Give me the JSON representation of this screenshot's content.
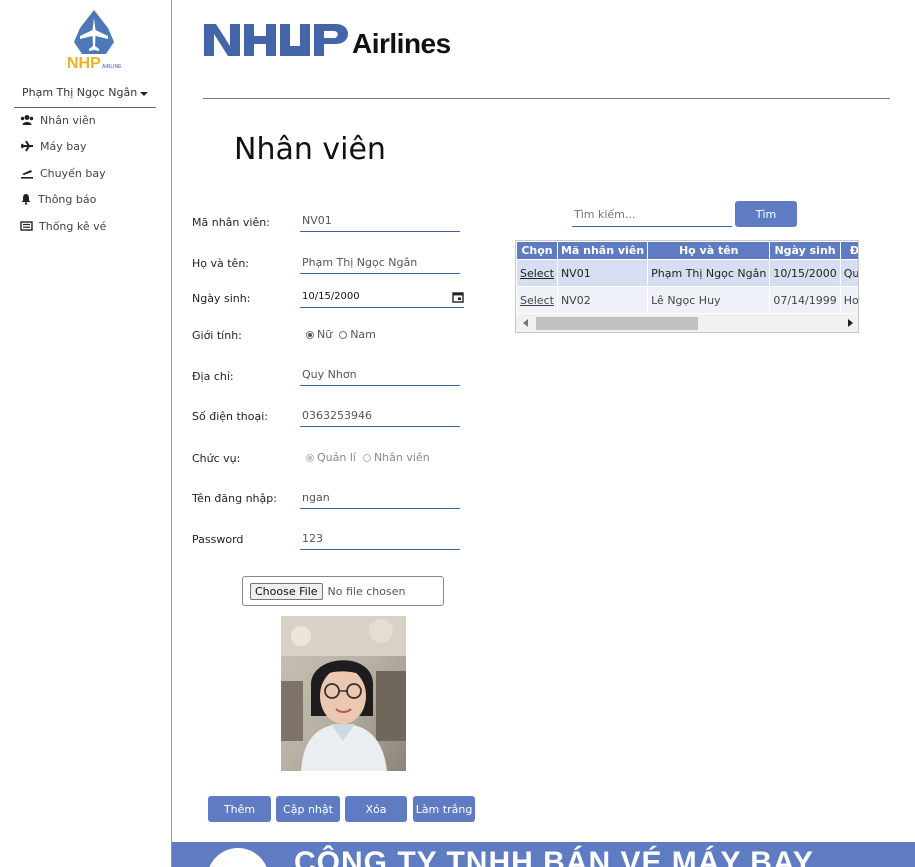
{
  "sidebar": {
    "logo_text": "NHP AIRLINE",
    "user_name": "Phạm Thị Ngọc Ngân",
    "items": [
      {
        "label": "Nhân viên",
        "icon": "users-icon"
      },
      {
        "label": "Máy bay",
        "icon": "plane-icon"
      },
      {
        "label": "Chuyến bay",
        "icon": "departure-icon"
      },
      {
        "label": "Thông báo",
        "icon": "bell-icon"
      },
      {
        "label": "Thống kê vé",
        "icon": "list-icon"
      }
    ]
  },
  "header": {
    "brand_name": "Airlines",
    "page_title": "Nhân viên"
  },
  "form": {
    "ma_label": "Mã nhân viên:",
    "ma_value": "NV01",
    "hoten_label": "Họ và tên:",
    "hoten_value": "Phạm Thị Ngọc Ngân",
    "ngaysinh_label": "Ngày sinh:",
    "ngaysinh_value": "10/15/2000",
    "gioitinh_label": "Giới tính:",
    "gender_options": [
      "Nữ",
      "Nam"
    ],
    "gender_selected": "Nữ",
    "diachi_label": "Địa chỉ:",
    "diachi_value": "Quy Nhơn",
    "sdt_label": "Số điện thoại:",
    "sdt_value": "0363253946",
    "chucvu_label": "Chức vụ:",
    "role_options": [
      "Quản lí",
      "Nhân viên"
    ],
    "role_selected": "Quản lí",
    "dangnhap_label": "Tên đăng nhập:",
    "dangnhap_value": "ngan",
    "password_label": "Password",
    "password_value": "123",
    "choose_file_label": "Choose File",
    "file_status": "No file chosen"
  },
  "buttons": {
    "them": "Thêm",
    "capnhat": "Cập nhật",
    "xoa": "Xóa",
    "lamtrang": "Làm trắng"
  },
  "search": {
    "placeholder": "Tìm kiếm...",
    "button_label": "Tìm"
  },
  "table": {
    "columns": [
      "Chọn",
      "Mã nhân viên",
      "Họ và tên",
      "Ngày sinh",
      "Địa chỉ"
    ],
    "rows": [
      {
        "select": "Select",
        "ma": "NV01",
        "ten": "Phạm Thị Ngọc Ngân",
        "ngaysinh": "10/15/2000",
        "diachi": "Quy Nhơn"
      },
      {
        "select": "Select",
        "ma": "NV02",
        "ten": "Lê Ngọc Huy",
        "ngaysinh": "07/14/1999",
        "diachi": "Hoài Ân"
      }
    ]
  },
  "footer": {
    "banner_text": "CÔNG TY TNHH BÁN VÉ MÁY BAY"
  },
  "colors": {
    "accent": "#5f7cc3",
    "logo_blue": "#3d5fa6",
    "row_selected": "#d6dff1"
  }
}
